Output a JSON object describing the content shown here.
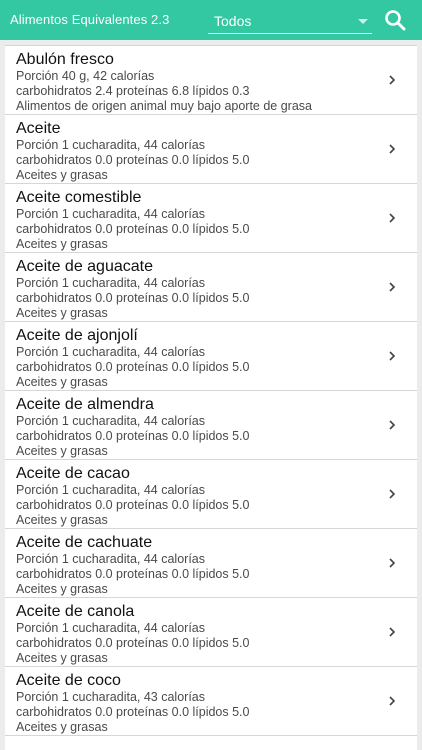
{
  "app_bar": {
    "title": "Alimentos Equivalentes 2.3",
    "filter_value": "Todos",
    "icons": {
      "search": "search-icon",
      "dropdown": "chevron-down-icon"
    },
    "colors": {
      "accent": "#33c7a2"
    }
  },
  "list": {
    "items": [
      {
        "name": "Abulón fresco",
        "portion": "Porción 40 g, 42 calorías",
        "macros": "carbohidratos 2.4 proteínas 6.8 lípidos 0.3",
        "group": "Alimentos de origen animal muy bajo aporte de grasa"
      },
      {
        "name": "Aceite",
        "portion": "Porción 1 cucharadita, 44 calorías",
        "macros": "carbohidratos 0.0 proteínas 0.0 lípidos 5.0",
        "group": "Aceites y grasas"
      },
      {
        "name": "Aceite comestible",
        "portion": "Porción 1 cucharadita, 44 calorías",
        "macros": "carbohidratos 0.0 proteínas 0.0 lípidos 5.0",
        "group": "Aceites y grasas"
      },
      {
        "name": "Aceite de aguacate",
        "portion": "Porción 1 cucharadita, 44 calorías",
        "macros": "carbohidratos 0.0 proteínas 0.0 lípidos 5.0",
        "group": "Aceites y grasas"
      },
      {
        "name": "Aceite de ajonjolí",
        "portion": "Porción 1 cucharadita, 44 calorías",
        "macros": "carbohidratos 0.0 proteínas 0.0 lípidos 5.0",
        "group": "Aceites y grasas"
      },
      {
        "name": "Aceite de almendra",
        "portion": "Porción 1 cucharadita, 44 calorías",
        "macros": "carbohidratos 0.0 proteínas 0.0 lípidos 5.0",
        "group": "Aceites y grasas"
      },
      {
        "name": "Aceite de cacao",
        "portion": "Porción 1 cucharadita, 44 calorías",
        "macros": "carbohidratos 0.0 proteínas 0.0 lípidos 5.0",
        "group": "Aceites y grasas"
      },
      {
        "name": "Aceite de cachuate",
        "portion": "Porción 1 cucharadita, 44 calorías",
        "macros": "carbohidratos 0.0 proteínas 0.0 lípidos 5.0",
        "group": "Aceites y grasas"
      },
      {
        "name": "Aceite de canola",
        "portion": "Porción 1 cucharadita, 44 calorías",
        "macros": "carbohidratos 0.0 proteínas 0.0 lípidos 5.0",
        "group": "Aceites y grasas"
      },
      {
        "name": "Aceite de coco",
        "portion": "Porción 1 cucharadita, 43 calorías",
        "macros": "carbohidratos 0.0 proteínas 0.0 lípidos 5.0",
        "group": "Aceites y grasas"
      }
    ],
    "row_icon": "chevron-right-icon"
  }
}
